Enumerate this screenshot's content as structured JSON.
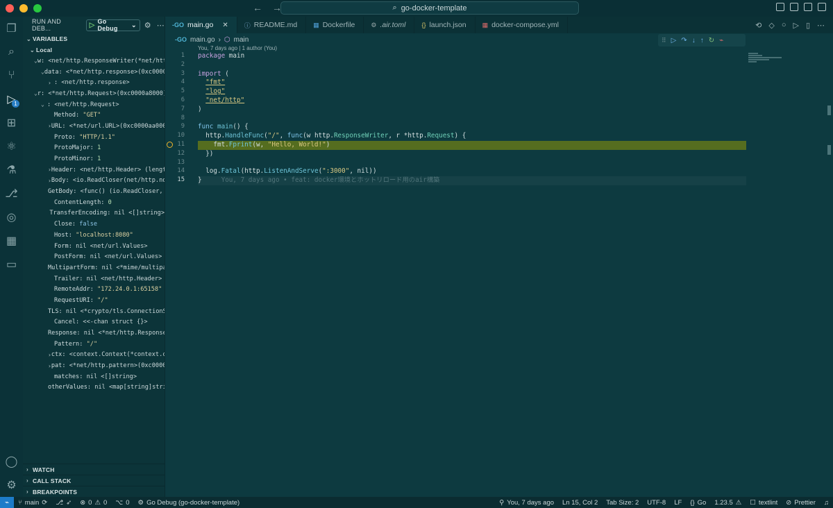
{
  "window": {
    "title": "go-docker-template"
  },
  "run": {
    "header": "RUN AND DEB...",
    "config": "Go Debug",
    "sections": {
      "variables": "VARIABLES",
      "local": "Local",
      "watch": "WATCH",
      "callstack": "CALL STACK",
      "breakpoints": "BREAKPOINTS"
    }
  },
  "variables": [
    {
      "indent": 1,
      "chevron": "open",
      "name": "w:",
      "value": "<net/http.ResponseWriter(*net/htt…",
      "type": ""
    },
    {
      "indent": 2,
      "chevron": "open",
      "name": "data:",
      "value": "<*net/http.response>(0xc0000…",
      "type": ""
    },
    {
      "indent": 3,
      "chevron": "closed",
      "name": ":",
      "value": "<net/http.response>",
      "type": ""
    },
    {
      "indent": 1,
      "chevron": "open",
      "name": "r:",
      "value": "<*net/http.Request>(0xc0000a8000)",
      "type": ""
    },
    {
      "indent": 2,
      "chevron": "open",
      "name": ":",
      "value": "<net/http.Request>",
      "type": ""
    },
    {
      "indent": 3,
      "chevron": "",
      "name": "Method:",
      "value": "\"GET\"",
      "type": "str"
    },
    {
      "indent": 3,
      "chevron": "closed",
      "name": "URL:",
      "value": "<*net/url.URL>(0xc0000aa000)",
      "type": ""
    },
    {
      "indent": 3,
      "chevron": "",
      "name": "Proto:",
      "value": "\"HTTP/1.1\"",
      "type": "str"
    },
    {
      "indent": 3,
      "chevron": "",
      "name": "ProtoMajor:",
      "value": "1",
      "type": "num"
    },
    {
      "indent": 3,
      "chevron": "",
      "name": "ProtoMinor:",
      "value": "1",
      "type": "num"
    },
    {
      "indent": 3,
      "chevron": "closed",
      "name": "Header:",
      "value": "<net/http.Header> (length:…",
      "type": ""
    },
    {
      "indent": 3,
      "chevron": "closed",
      "name": "Body:",
      "value": "<io.ReadCloser(net/http.noBo…",
      "type": ""
    },
    {
      "indent": 3,
      "chevron": "",
      "name": "GetBody:",
      "value": "<func() (io.ReadCloser, e…",
      "type": ""
    },
    {
      "indent": 3,
      "chevron": "",
      "name": "ContentLength:",
      "value": "0",
      "type": "num"
    },
    {
      "indent": 3,
      "chevron": "",
      "name": "TransferEncoding:",
      "value": "nil <[]string>",
      "type": ""
    },
    {
      "indent": 3,
      "chevron": "",
      "name": "Close:",
      "value": "false",
      "type": "kw"
    },
    {
      "indent": 3,
      "chevron": "",
      "name": "Host:",
      "value": "\"localhost:8080\"",
      "type": "str"
    },
    {
      "indent": 3,
      "chevron": "",
      "name": "Form:",
      "value": "nil <net/url.Values>",
      "type": ""
    },
    {
      "indent": 3,
      "chevron": "",
      "name": "PostForm:",
      "value": "nil <net/url.Values>",
      "type": ""
    },
    {
      "indent": 3,
      "chevron": "",
      "name": "MultipartForm:",
      "value": "nil <*mime/multipar…",
      "type": ""
    },
    {
      "indent": 3,
      "chevron": "",
      "name": "Trailer:",
      "value": "nil <net/http.Header>",
      "type": ""
    },
    {
      "indent": 3,
      "chevron": "",
      "name": "RemoteAddr:",
      "value": "\"172.24.0.1:65158\"",
      "type": "str"
    },
    {
      "indent": 3,
      "chevron": "",
      "name": "RequestURI:",
      "value": "\"/\"",
      "type": "str"
    },
    {
      "indent": 3,
      "chevron": "",
      "name": "TLS:",
      "value": "nil <*crypto/tls.ConnectionSt…",
      "type": ""
    },
    {
      "indent": 3,
      "chevron": "",
      "name": "Cancel:",
      "value": "<<-chan struct {}>",
      "type": ""
    },
    {
      "indent": 3,
      "chevron": "",
      "name": "Response:",
      "value": "nil <*net/http.Response>",
      "type": ""
    },
    {
      "indent": 3,
      "chevron": "",
      "name": "Pattern:",
      "value": "\"/\"",
      "type": "str"
    },
    {
      "indent": 3,
      "chevron": "closed",
      "name": "ctx:",
      "value": "<context.Context(*context.can…",
      "type": ""
    },
    {
      "indent": 3,
      "chevron": "closed",
      "name": "pat:",
      "value": "<*net/http.pattern>(0xc000028…",
      "type": ""
    },
    {
      "indent": 3,
      "chevron": "",
      "name": "matches:",
      "value": "nil <[]string>",
      "type": ""
    },
    {
      "indent": 3,
      "chevron": "",
      "name": "otherValues:",
      "value": "nil <map[string]strin…",
      "type": ""
    }
  ],
  "tabs": [
    {
      "label": "main.go",
      "icon": "go-icon",
      "active": true
    },
    {
      "label": "README.md",
      "icon": "info-icon",
      "active": false
    },
    {
      "label": "Dockerfile",
      "icon": "docker-icon",
      "active": false
    },
    {
      "label": ".air.toml",
      "icon": "gear-icon",
      "active": false
    },
    {
      "label": "launch.json",
      "icon": "json-icon",
      "active": false
    },
    {
      "label": "docker-compose.yml",
      "icon": "docker-compose-icon",
      "active": false
    }
  ],
  "breadcrumb": {
    "file": "main.go",
    "symbol": "main"
  },
  "editor": {
    "blame_top": "You, 7 days ago | 1 author (You)",
    "line_numbers": [
      "1",
      "2",
      "3",
      "4",
      "5",
      "6",
      "7",
      "8",
      "9",
      "10",
      "11",
      "12",
      "13",
      "14",
      "15"
    ],
    "current_line": "15",
    "paused_line": "11",
    "ghost_blame": "You, 7 days ago • feat: docker環境とホットリロード用のair構築"
  },
  "status": {
    "branch": "main",
    "errors": "0",
    "warnings": "0",
    "ports": "0",
    "debug": "Go Debug (go-docker-template)",
    "blame": "You, 7 days ago",
    "position": "Ln 15, Col 2",
    "tab_size": "Tab Size: 2",
    "encoding": "UTF-8",
    "eol": "LF",
    "language": "Go",
    "go_version": "1.23.5",
    "textlint": "textlint",
    "prettier": "Prettier"
  },
  "colors": {
    "accent": "#1d7cc9",
    "paused_line": "#556d1f",
    "breakpoint": "#f0b429"
  }
}
